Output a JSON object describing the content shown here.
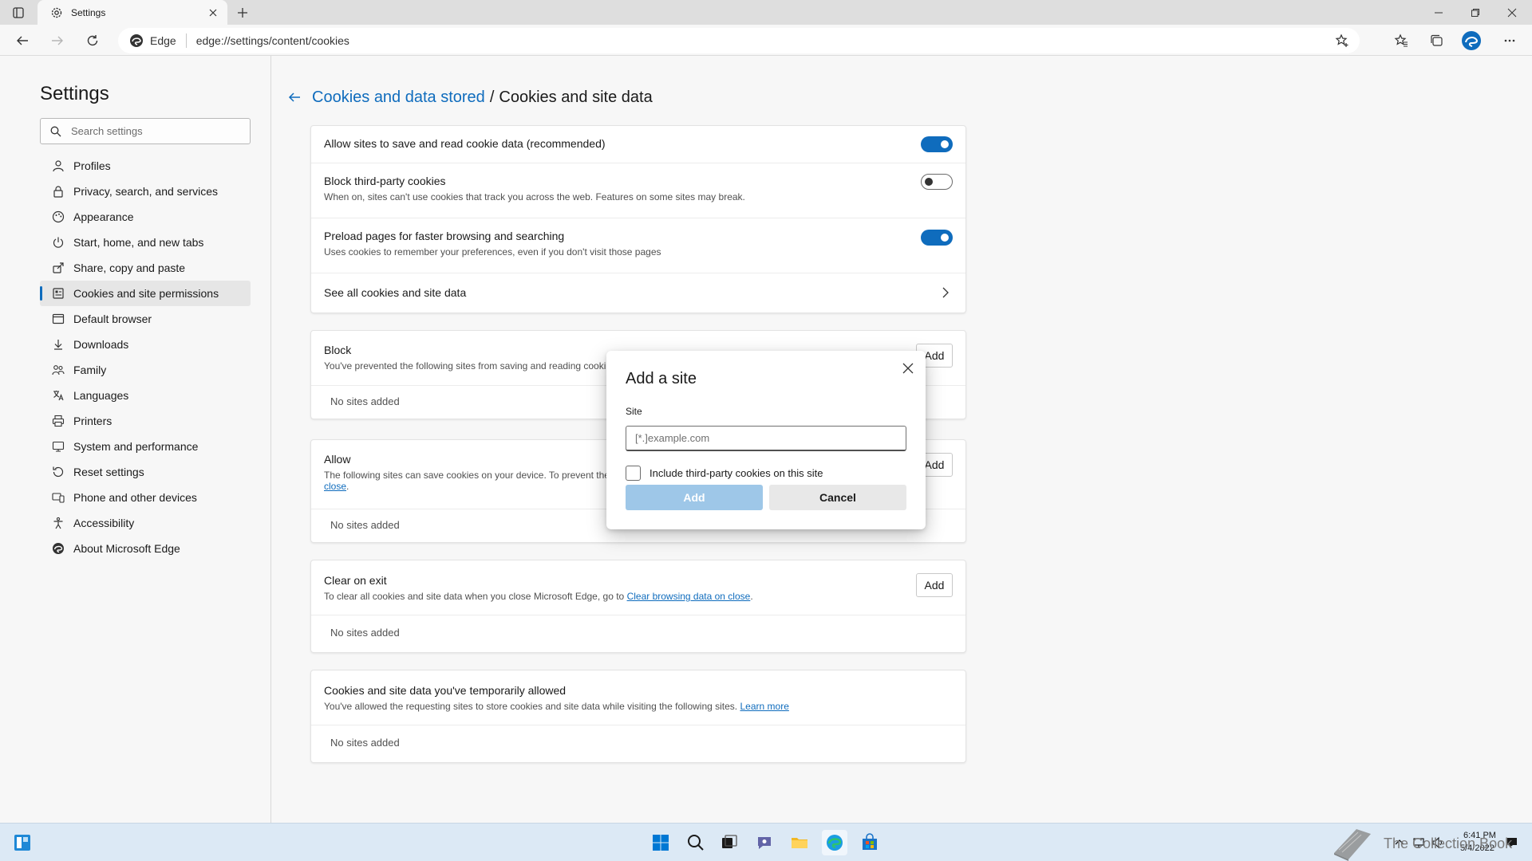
{
  "browser": {
    "tab_title": "Settings",
    "address_label": "Edge",
    "url": "edge://settings/content/cookies"
  },
  "nav": {
    "title": "Settings",
    "search_placeholder": "Search settings",
    "items": [
      {
        "label": "Profiles",
        "icon": "profile-icon"
      },
      {
        "label": "Privacy, search, and services",
        "icon": "lock-icon"
      },
      {
        "label": "Appearance",
        "icon": "appearance-icon"
      },
      {
        "label": "Start, home, and new tabs",
        "icon": "power-icon"
      },
      {
        "label": "Share, copy and paste",
        "icon": "share-icon"
      },
      {
        "label": "Cookies and site permissions",
        "icon": "cookie-icon",
        "active": true
      },
      {
        "label": "Default browser",
        "icon": "browser-icon"
      },
      {
        "label": "Downloads",
        "icon": "download-icon"
      },
      {
        "label": "Family",
        "icon": "family-icon"
      },
      {
        "label": "Languages",
        "icon": "language-icon"
      },
      {
        "label": "Printers",
        "icon": "printer-icon"
      },
      {
        "label": "System and performance",
        "icon": "system-icon"
      },
      {
        "label": "Reset settings",
        "icon": "reset-icon"
      },
      {
        "label": "Phone and other devices",
        "icon": "phone-icon"
      },
      {
        "label": "Accessibility",
        "icon": "accessibility-icon"
      },
      {
        "label": "About Microsoft Edge",
        "icon": "edge-icon"
      }
    ]
  },
  "page": {
    "breadcrumb_parent": "Cookies and data stored",
    "breadcrumb_sep": "/",
    "breadcrumb_current": "Cookies and site data",
    "settings": {
      "allow_cookies": {
        "title": "Allow sites to save and read cookie data (recommended)",
        "on": true
      },
      "block_third_party": {
        "title": "Block third-party cookies",
        "desc": "When on, sites can't use cookies that track you across the web. Features on some sites may break.",
        "on": false
      },
      "preload": {
        "title": "Preload pages for faster browsing and searching",
        "desc": "Uses cookies to remember your preferences, even if you don't visit those pages",
        "on": true
      },
      "see_all": "See all cookies and site data"
    },
    "block": {
      "title": "Block",
      "desc": "You've prevented the following sites from saving and reading cooki",
      "add": "Add",
      "empty": "No sites added"
    },
    "allow": {
      "title": "Allow",
      "desc": "The following sites can save cookies on your device. To prevent the",
      "desc_link": "close",
      "add": "Add",
      "empty": "No sites added"
    },
    "clear_on_exit": {
      "title": "Clear on exit",
      "desc": "To clear all cookies and site data when you close Microsoft Edge, go to",
      "desc_link": "Clear browsing data on close",
      "desc_end": ".",
      "add": "Add",
      "empty": "No sites added"
    },
    "temp_allowed": {
      "title": "Cookies and site data you've temporarily allowed",
      "desc": "You've allowed the requesting sites to store cookies and site data while visiting the following sites.",
      "desc_link": "Learn more",
      "empty": "No sites added"
    }
  },
  "dialog": {
    "title": "Add a site",
    "site_label": "Site",
    "site_placeholder": "[*.]example.com",
    "site_value": "",
    "checkbox_label": "Include third-party cookies on this site",
    "checkbox_checked": false,
    "add_label": "Add",
    "cancel_label": "Cancel"
  },
  "taskbar": {
    "time": "6:41 PM",
    "date": "5/4/2022",
    "watermark": "The Collection Book"
  },
  "colors": {
    "accent": "#0f6cbd",
    "add_disabled": "#9ec7e8"
  }
}
